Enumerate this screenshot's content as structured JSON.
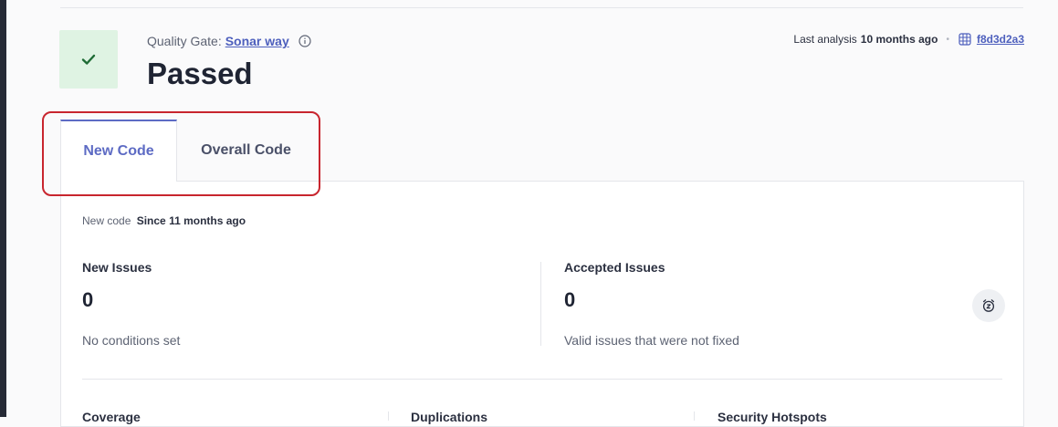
{
  "quality_gate": {
    "label": "Quality Gate:",
    "name": "Sonar way",
    "status": "Passed",
    "status_color": "#dff3e3",
    "icons": {
      "status": "check-icon",
      "info": "info-icon"
    }
  },
  "analysis": {
    "prefix": "Last analysis",
    "when": "10 months ago",
    "separator": "•",
    "commit_hash": "f8d3d2a3",
    "commit_icon": "commit-icon"
  },
  "tabs": [
    {
      "label": "New Code",
      "active": true
    },
    {
      "label": "Overall Code",
      "active": false
    }
  ],
  "new_code": {
    "label": "New code",
    "since": "Since 11 months ago"
  },
  "metrics": {
    "new_issues": {
      "title": "New Issues",
      "value": "0",
      "subtitle": "No conditions set"
    },
    "accepted_issues": {
      "title": "Accepted Issues",
      "value": "0",
      "subtitle": "Valid issues that were not fixed",
      "icon": "snooze-icon"
    }
  },
  "bottom_metrics": [
    {
      "title": "Coverage"
    },
    {
      "title": "Duplications"
    },
    {
      "title": "Security Hotspots"
    }
  ],
  "colors": {
    "accent": "#5d6bc4",
    "highlight": "#c8252e"
  }
}
